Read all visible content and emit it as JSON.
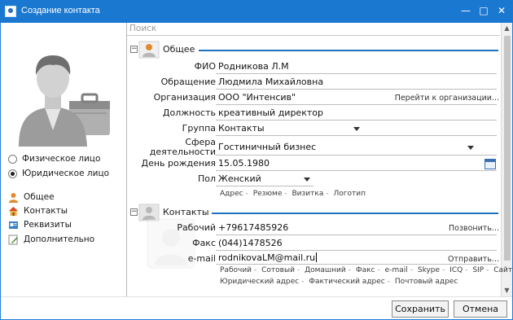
{
  "window": {
    "title": "Создание контакта",
    "controls": {
      "minimize": "—",
      "maximize": "□",
      "close": "✕"
    }
  },
  "left": {
    "person_types": [
      {
        "label": "Физическое лицо",
        "selected": false
      },
      {
        "label": "Юридическое лицо",
        "selected": true
      }
    ],
    "nav": [
      {
        "label": "Общее",
        "icon": "person-icon"
      },
      {
        "label": "Контакты",
        "icon": "house-icon"
      },
      {
        "label": "Реквизиты",
        "icon": "card-icon"
      },
      {
        "label": "Дополнительно",
        "icon": "edit-icon"
      }
    ]
  },
  "search": {
    "placeholder": "Поиск"
  },
  "general": {
    "title": "Общее",
    "fio_label": "ФИО",
    "fio_value": "Родникова Л.М",
    "greeting_label": "Обращение",
    "greeting_value": "Людмила Михайловна",
    "org_label": "Организация",
    "org_value": "ООО \"Интенсив\"",
    "org_link": "Перейти к организации...",
    "position_label": "Должность",
    "position_value": "креативный директор",
    "group_label": "Группа",
    "group_value": "Контакты",
    "sphere_label_1": "Сфера",
    "sphere_label_2": "деятельности",
    "sphere_value": "Гостиничный бизнес",
    "birthday_label": "День рождения",
    "birthday_value": "15.05.1980",
    "gender_label": "Пол",
    "gender_value": "Женский",
    "sub_links": [
      "Адрес",
      "Резюме",
      "Визитка",
      "Логотип"
    ]
  },
  "contacts": {
    "title": "Контакты",
    "work_label": "Рабочий",
    "work_value": "+79617485926",
    "work_link": "Позвонить...",
    "fax_label": "Факс",
    "fax_value": "(044)1478526",
    "email_label": "e-mail",
    "email_value": "rodnikovaLM@mail.ru",
    "email_link": "Отправить...",
    "sub_links_1": [
      "Рабочий",
      "Сотовый",
      "Домашний",
      "Факс",
      "e-mail",
      "Skype",
      "ICQ",
      "SIP",
      "Сайт"
    ],
    "sub_links_2": [
      "Юридический адрес",
      "Фактический адрес",
      "Почтовый адрес"
    ]
  },
  "buttons": {
    "save": "Сохранить",
    "cancel": "Отмена"
  },
  "colors": {
    "titlebar": "#1a78d0",
    "accent_line": "#1e73be"
  }
}
